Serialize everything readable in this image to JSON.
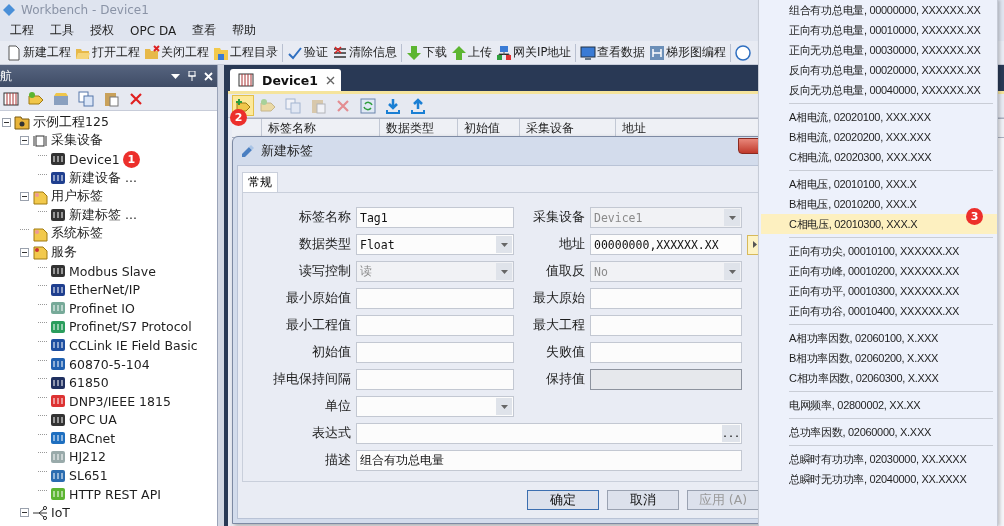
{
  "window": {
    "title": "Workbench - Device1"
  },
  "menu_bar": [
    "工程",
    "工具",
    "授权",
    "OPC DA",
    "查看",
    "帮助"
  ],
  "toolbar": {
    "groups": [
      {
        "items": [
          {
            "kind": "new",
            "label": "新建工程"
          },
          {
            "kind": "open",
            "label": "打开工程"
          },
          {
            "kind": "close",
            "label": "关闭工程"
          },
          {
            "kind": "folder",
            "label": "工程目录"
          }
        ]
      },
      {
        "items": [
          {
            "kind": "check",
            "label": "验证"
          },
          {
            "kind": "clear",
            "label": "清除信息"
          }
        ]
      },
      {
        "items": [
          {
            "kind": "down",
            "label": "下载"
          },
          {
            "kind": "up",
            "label": "上传"
          },
          {
            "kind": "network",
            "label": "网关IP地址"
          }
        ]
      },
      {
        "items": [
          {
            "kind": "monitor",
            "label": "查看数据"
          },
          {
            "kind": "ladder",
            "label": "梯形图编程"
          }
        ]
      },
      {
        "items": [
          {
            "kind": "help"
          }
        ]
      }
    ]
  },
  "nav_panel": {
    "title": "航",
    "toolbar": [
      {
        "kind": "device"
      },
      {
        "kind": "tag"
      },
      {
        "kind": "props"
      },
      {
        "kind": "copy"
      },
      {
        "kind": "paste"
      },
      {
        "kind": "delete"
      }
    ],
    "tree": [
      {
        "label": "示例工程125",
        "expanded": true,
        "children": [
          {
            "label": "采集设备",
            "expanded": true,
            "children": [
              {
                "label": "Device1",
                "badge": "1"
              },
              {
                "label": "新建设备 ..."
              }
            ]
          },
          {
            "label": "用户标签",
            "expanded": true,
            "children": [
              {
                "label": "新建标签 ..."
              }
            ]
          },
          {
            "label": "系统标签"
          },
          {
            "label": "服务",
            "expanded": true,
            "children": [
              {
                "label": "Modbus Slave"
              },
              {
                "label": "EtherNet/IP"
              },
              {
                "label": "Profinet IO"
              },
              {
                "label": "Profinet/S7 Protocol"
              },
              {
                "label": "CCLink IE Field Basic"
              },
              {
                "label": "60870-5-104"
              },
              {
                "label": "61850"
              },
              {
                "label": "DNP3/IEEE 1815"
              },
              {
                "label": "OPC UA"
              },
              {
                "label": "BACnet"
              },
              {
                "label": "HJ212"
              },
              {
                "label": "SL651"
              },
              {
                "label": "HTTP REST API"
              }
            ]
          },
          {
            "label": "IoT",
            "expanded": true
          }
        ]
      }
    ]
  },
  "document": {
    "tabs": [
      {
        "label": "Device1",
        "selected": true
      }
    ],
    "toolbar": [
      {
        "kind": "new-tag",
        "highlighted": true,
        "disabled": false,
        "badge": "2"
      },
      {
        "kind": "tag",
        "highlighted": false,
        "disabled": true
      },
      {
        "kind": "copy",
        "highlighted": false,
        "disabled": true
      },
      {
        "kind": "paste",
        "highlighted": false,
        "disabled": true
      },
      {
        "kind": "delete",
        "highlighted": false,
        "disabled": true
      },
      {
        "kind": "refresh",
        "highlighted": false,
        "disabled": false
      },
      {
        "kind": "download",
        "highlighted": false,
        "disabled": false
      },
      {
        "kind": "upload",
        "highlighted": false,
        "disabled": false
      }
    ],
    "table": {
      "columns": [
        "标签名称",
        "数据类型",
        "初始值",
        "采集设备",
        "地址"
      ]
    }
  },
  "dialog": {
    "title": "新建标签",
    "tabs": [
      {
        "label": "常规",
        "selected": true
      }
    ],
    "rows": [
      {
        "fields": [
          {
            "label": "标签名称",
            "kind": "text",
            "value": "Tag1",
            "disabled": false
          },
          {
            "label": "采集设备",
            "kind": "combo",
            "value": "Device1",
            "disabled": true
          }
        ]
      },
      {
        "fields": [
          {
            "label": "数据类型",
            "kind": "combo",
            "value": "Float",
            "disabled": false
          },
          {
            "label": "地址",
            "kind": "address",
            "value": "00000000,XXXXXX.XX",
            "disabled": false
          }
        ]
      },
      {
        "fields": [
          {
            "label": "读写控制",
            "kind": "combo",
            "value": "读",
            "disabled": true
          },
          {
            "label": "值取反",
            "kind": "combo",
            "value": "No",
            "disabled": true
          }
        ]
      },
      {
        "fields": [
          {
            "label": "最小原始值",
            "kind": "text",
            "disabled": false
          },
          {
            "label": "最大原始",
            "kind": "text",
            "disabled": false
          }
        ]
      },
      {
        "fields": [
          {
            "label": "最小工程值",
            "kind": "text",
            "disabled": false
          },
          {
            "label": "最大工程",
            "kind": "text",
            "disabled": false
          }
        ]
      },
      {
        "fields": [
          {
            "label": "初始值",
            "kind": "text",
            "disabled": false
          },
          {
            "label": "失败值",
            "kind": "text",
            "disabled": false
          }
        ]
      },
      {
        "fields": [
          {
            "label": "掉电保持间隔",
            "kind": "text",
            "disabled": false
          },
          {
            "label": "保持值",
            "kind": "text",
            "disabled": true
          }
        ]
      },
      {
        "fields": [
          {
            "label": "单位",
            "kind": "combo"
          }
        ]
      },
      {
        "fields": [
          {
            "label": "表达式",
            "kind": "expression",
            "button_label": "..."
          }
        ]
      },
      {
        "fields": [
          {
            "label": "描述",
            "kind": "wide",
            "value": "组合有功总电量",
            "disabled": false
          }
        ]
      }
    ],
    "buttons": [
      {
        "label": "确定",
        "default": true,
        "disabled": false
      },
      {
        "label": "取消",
        "default": false,
        "disabled": false
      },
      {
        "label": "应用 (A)",
        "default": false,
        "disabled": true
      }
    ]
  },
  "address_menu": {
    "groups": [
      {
        "items": [
          {
            "label": "组合有功总电量, 00000000, XXXXXX.XX",
            "selected": false
          },
          {
            "label": "正向有功总电量, 00010000, XXXXXX.XX",
            "selected": false
          },
          {
            "label": "正向无功总电量, 00030000, XXXXXX.XX",
            "selected": false
          },
          {
            "label": "反向有功总电量, 00020000, XXXXXX.XX",
            "selected": false
          },
          {
            "label": "反向无功总电量, 00040000, XXXXXX.XX",
            "selected": false
          }
        ]
      },
      {
        "items": [
          {
            "label": "A相电流, 02020100, XXX.XXX",
            "selected": false
          },
          {
            "label": "B相电流, 02020200, XXX.XXX",
            "selected": false
          },
          {
            "label": "C相电流, 02020300, XXX.XXX",
            "selected": false
          }
        ]
      },
      {
        "items": [
          {
            "label": "A相电压, 02010100, XXX.X",
            "selected": false
          },
          {
            "label": "B相电压, 02010200, XXX.X",
            "selected": false
          },
          {
            "label": "C相电压, 02010300, XXX.X",
            "selected": true,
            "badge": "3"
          }
        ]
      },
      {
        "items": [
          {
            "label": "正向有功尖, 00010100, XXXXXX.XX",
            "selected": false
          },
          {
            "label": "正向有功峰, 00010200, XXXXXX.XX",
            "selected": false
          },
          {
            "label": "正向有功平, 00010300, XXXXXX.XX",
            "selected": false
          },
          {
            "label": "正向有功谷, 00010400, XXXXXX.XX",
            "selected": false
          }
        ]
      },
      {
        "items": [
          {
            "label": "A相功率因数, 02060100, X.XXX",
            "selected": false
          },
          {
            "label": "B相功率因数, 02060200, X.XXX",
            "selected": false
          },
          {
            "label": "C相功率因数, 02060300, X.XXX",
            "selected": false
          }
        ]
      },
      {
        "items": [
          {
            "label": "电网频率, 02800002, XX.XX",
            "selected": false
          }
        ]
      },
      {
        "items": [
          {
            "label": "总功率因数, 02060000, X.XXX",
            "selected": false
          }
        ]
      },
      {
        "items": [
          {
            "label": "总瞬时有功功率, 02030000, XX.XXXX",
            "selected": false
          },
          {
            "label": "总瞬时无功功率, 02040000, XX.XXXX",
            "selected": false
          }
        ]
      }
    ]
  }
}
